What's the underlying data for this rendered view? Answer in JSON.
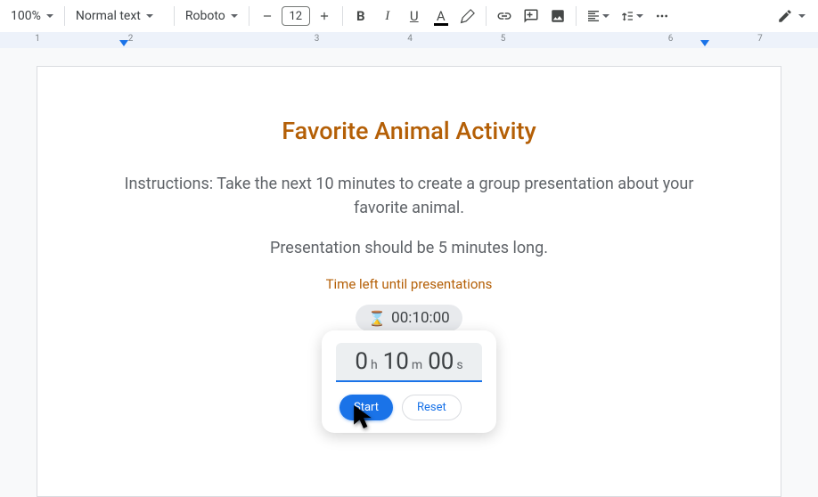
{
  "toolbar": {
    "zoom": "100%",
    "style": "Normal text",
    "font": "Roboto",
    "fontSize": "12"
  },
  "ruler": {
    "numbers": [
      "1",
      "2",
      "3",
      "4",
      "5",
      "6",
      "7"
    ]
  },
  "doc": {
    "title": "Favorite Animal Activity",
    "instructions": "Instructions: Take the next 10 minutes to create a group presentation about your favorite animal.",
    "length_note": "Presentation should be 5 minutes long.",
    "timer_label": "Time left until presentations"
  },
  "timer_chip": {
    "value": "00:10:00"
  },
  "timer_card": {
    "h": "0",
    "h_unit": "h",
    "m": "10",
    "m_unit": "m",
    "s": "00",
    "s_unit": "s",
    "start_label": "Start",
    "reset_label": "Reset"
  }
}
